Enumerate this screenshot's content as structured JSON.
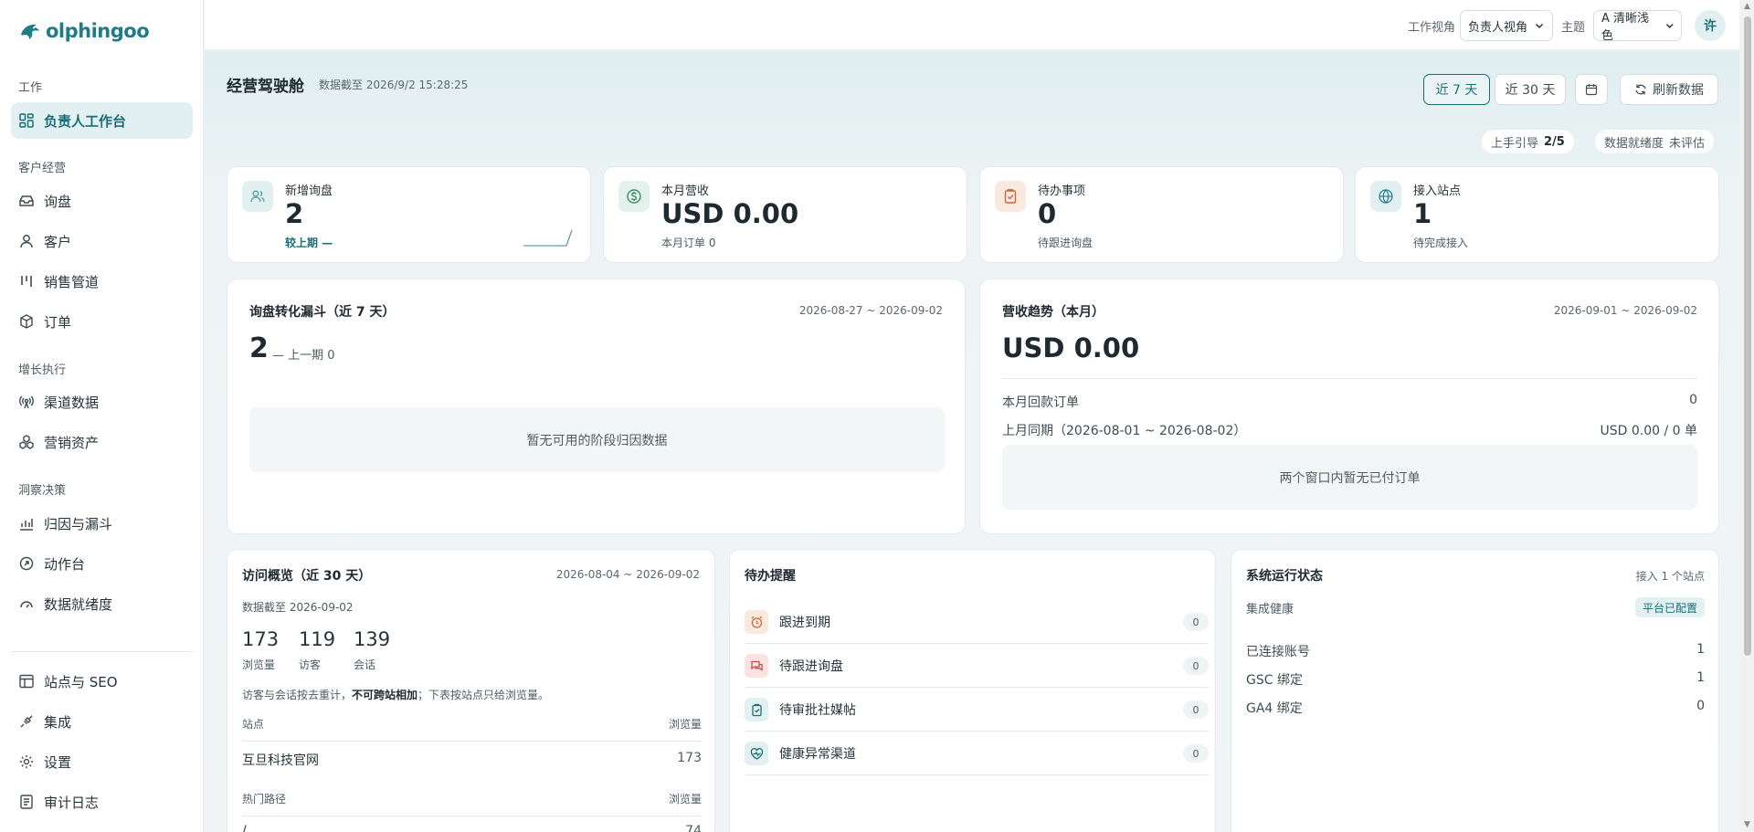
{
  "app": {
    "logo_text": "olphingoo"
  },
  "sidebar": {
    "sections": [
      {
        "title": "工作"
      },
      {
        "title": "客户经营"
      },
      {
        "title": "增长执行"
      },
      {
        "title": "洞察决策"
      }
    ],
    "items": [
      {
        "label": "负责人工作台",
        "icon": "dashboard-icon",
        "active": true
      },
      {
        "label": "询盘",
        "icon": "inbox-icon"
      },
      {
        "label": "客户",
        "icon": "user-icon"
      },
      {
        "label": "销售管道",
        "icon": "pipeline-icon"
      },
      {
        "label": "订单",
        "icon": "package-icon"
      },
      {
        "label": "渠道数据",
        "icon": "broadcast-icon"
      },
      {
        "label": "营销资产",
        "icon": "assets-icon"
      },
      {
        "label": "归因与漏斗",
        "icon": "chart-icon"
      },
      {
        "label": "动作台",
        "icon": "action-icon"
      },
      {
        "label": "数据就绪度",
        "icon": "gauge-icon"
      },
      {
        "label": "站点与 SEO",
        "icon": "site-icon"
      },
      {
        "label": "集成",
        "icon": "plug-icon"
      },
      {
        "label": "设置",
        "icon": "gear-icon"
      },
      {
        "label": "审计日志",
        "icon": "log-icon"
      }
    ]
  },
  "topbar": {
    "view_label": "工作视角",
    "view_value": "负责人视角",
    "theme_label": "主题",
    "theme_value": "A 清晰浅色",
    "avatar": "许"
  },
  "header": {
    "title": "经营驾驶舱",
    "subtitle": "数据截至 2026/9/2 15:28:25",
    "range_7": "近 7 天",
    "range_30": "近 30 天",
    "refresh": "刷新数据",
    "onboarding_label": "上手引导",
    "onboarding_value": "2/5",
    "readiness_label": "数据就绪度",
    "readiness_value": "未评估"
  },
  "kpis": [
    {
      "label": "新增询盘",
      "value": "2",
      "sub": "较上期 —",
      "icon": "users-icon",
      "color": "#5aa3aa",
      "bg": "#e3f0f1"
    },
    {
      "label": "本月营收",
      "value": "USD 0.00",
      "sub": "本月订单 0",
      "icon": "dollar-icon",
      "color": "#3f8c6b",
      "bg": "#e4f1ec"
    },
    {
      "label": "待办事项",
      "value": "0",
      "sub": "待跟进询盘",
      "icon": "clipboard-icon",
      "color": "#c4683a",
      "bg": "#fbe9e0"
    },
    {
      "label": "接入站点",
      "value": "1",
      "sub": "待完成接入",
      "icon": "globe-icon",
      "color": "#2f7f92",
      "bg": "#e3f0f3"
    }
  ],
  "funnel": {
    "title": "询盘转化漏斗（近 7 天）",
    "date": "2026-08-27 ~ 2026-09-02",
    "value": "2",
    "compare": "— 上一期 0",
    "empty": "暂无可用的阶段归因数据"
  },
  "revenue": {
    "title": "营收趋势（本月）",
    "date": "2026-09-01 ~ 2026-09-02",
    "value": "USD 0.00",
    "row1_label": "本月回款订单",
    "row1_value": "0",
    "row2_label": "上月同期（2026-08-01 ~ 2026-08-02）",
    "row2_value": "USD 0.00 / 0 单",
    "empty": "两个窗口内暂无已付订单"
  },
  "visits": {
    "title": "访问概览（近 30 天）",
    "date": "2026-08-04 ~ 2026-09-02",
    "as_of": "数据截至 2026-09-02",
    "stats": [
      {
        "value": "173",
        "label": "浏览量"
      },
      {
        "value": "119",
        "label": "访客"
      },
      {
        "value": "139",
        "label": "会话"
      }
    ],
    "note_pre": "访客与会话按去重计，",
    "note_bold": "不可跨站相加",
    "note_post": "；下表按站点只给浏览量。",
    "site_header": "站点",
    "views_header": "浏览量",
    "sites": [
      {
        "name": "互旦科技官网",
        "views": "173"
      }
    ],
    "paths_header": "热门路径",
    "paths_views_header": "浏览量",
    "paths": [
      {
        "name": "/",
        "views": "74"
      }
    ]
  },
  "reminders": {
    "title": "待办提醒",
    "items": [
      {
        "label": "跟进到期",
        "count": "0",
        "icon": "alarm-icon"
      },
      {
        "label": "待跟进询盘",
        "count": "0",
        "icon": "chat-icon"
      },
      {
        "label": "待审批社媒帖",
        "count": "0",
        "icon": "clipboard-check-icon"
      },
      {
        "label": "健康异常渠道",
        "count": "0",
        "icon": "heart-pulse-icon"
      }
    ]
  },
  "system": {
    "title": "系统运行状态",
    "right": "接入 1 个站点",
    "health_label": "集成健康",
    "health_badge": "平台已配置",
    "rows": [
      {
        "label": "已连接账号",
        "value": "1"
      },
      {
        "label": "GSC 绑定",
        "value": "1"
      },
      {
        "label": "GA4 绑定",
        "value": "0"
      }
    ]
  }
}
